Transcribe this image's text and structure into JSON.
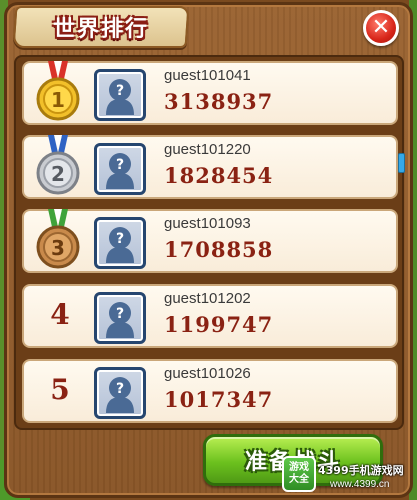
{
  "title": "世界排行",
  "close_label": "✕",
  "entries": [
    {
      "rank": "1",
      "medal": "gold",
      "name": "guest101041",
      "score": "3138937"
    },
    {
      "rank": "2",
      "medal": "silver",
      "name": "guest101220",
      "score": "1828454"
    },
    {
      "rank": "3",
      "medal": "bronze",
      "name": "guest101093",
      "score": "1708858"
    },
    {
      "rank": "4",
      "medal": "none",
      "name": "guest101202",
      "score": "1199747"
    },
    {
      "rank": "5",
      "medal": "none",
      "name": "guest101026",
      "score": "1017347"
    }
  ],
  "battle_button": "准备战斗",
  "watermark": {
    "badge_line1": "游戏",
    "badge_line2": "大全",
    "site": "4399手机游戏网",
    "url": "www.4399.cn"
  },
  "colors": {
    "gold": "#f2c02a",
    "silver": "#c9ccd1",
    "bronze": "#c98a4b",
    "rank_text": "#8a2213",
    "accent_green": "#6cc11e"
  }
}
